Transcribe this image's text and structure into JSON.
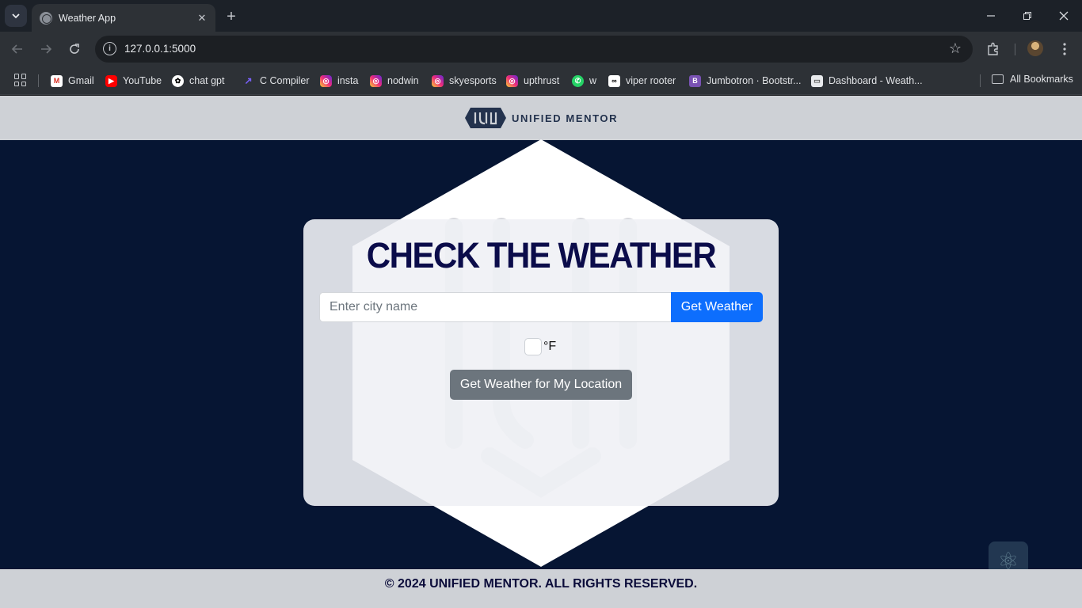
{
  "browser": {
    "tab_title": "Weather App",
    "url": "127.0.0.1:5000",
    "bookmarks": [
      {
        "label": "Gmail",
        "icon": "gmail-icon"
      },
      {
        "label": "YouTube",
        "icon": "youtube-icon"
      },
      {
        "label": "chat gpt",
        "icon": "chatgpt-icon"
      },
      {
        "label": "C Compiler",
        "icon": "c-compiler-icon"
      },
      {
        "label": "insta",
        "icon": "instagram-icon"
      },
      {
        "label": "nodwin",
        "icon": "instagram-icon"
      },
      {
        "label": "skyesports",
        "icon": "instagram-icon"
      },
      {
        "label": "upthrust",
        "icon": "instagram-icon"
      },
      {
        "label": "w",
        "icon": "whatsapp-icon"
      },
      {
        "label": "viper rooter",
        "icon": "viper-icon"
      },
      {
        "label": "Jumbotron · Bootstr...",
        "icon": "bootstrap-icon"
      },
      {
        "label": "Dashboard - Weath...",
        "icon": "dashboard-icon"
      }
    ],
    "all_bookmarks": "All Bookmarks"
  },
  "site": {
    "brand_name": "UNIFIED MENTOR",
    "card": {
      "title": "CHECK THE WEATHER",
      "city_placeholder": "Enter city name",
      "city_value": "",
      "get_weather_label": "Get Weather",
      "unit_label": "°F",
      "unit_checked": false,
      "location_button_label": "Get Weather for My Location"
    },
    "footer": "© 2024 UNIFIED MENTOR. ALL RIGHTS RESERVED."
  },
  "colors": {
    "page_background": "#061533",
    "header_footer": "#ced1d6",
    "title": "#0b0c4a",
    "primary_button": "#0d6efd",
    "secondary_button": "#6c757d"
  }
}
